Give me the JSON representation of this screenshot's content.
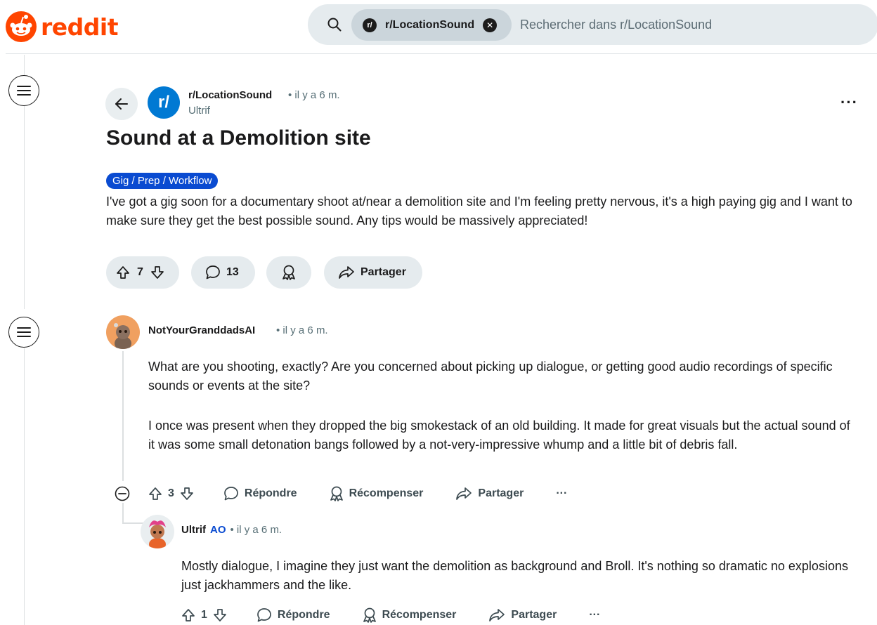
{
  "header": {
    "logo_text": "reddit",
    "search_chip": "r/LocationSound",
    "search_chip_avatar": "r/",
    "search_placeholder": "Rechercher dans r/LocationSound",
    "brand_color": "#ff4500"
  },
  "post": {
    "subreddit": "r/LocationSound",
    "subreddit_avatar": "r/",
    "time": "• il y a 6 m.",
    "author": "Ultrif",
    "title": "Sound at a Demolition site",
    "flair": "Gig / Prep / Workflow",
    "body": "I've got a gig soon for a documentary shoot at/near a demolition site and I'm feeling pretty nervous, it's a high paying gig and I want to make sure they get the best possible sound. Any tips would be massively appreciated!",
    "votes": "7",
    "comments": "13",
    "share_label": "Partager"
  },
  "comments": [
    {
      "author": "NotYourGranddadsAI",
      "time": "• il y a 6 m.",
      "paragraphs": [
        "What are you shooting, exactly? Are you concerned about picking up dialogue, or getting good audio recordings of specific sounds or events at the site?",
        "I once was present when they dropped the big smokestack of an old building. It made for great visuals but the actual sound of it was some small detonation bangs followed by a not-very-impressive whump and a little bit of debris fall."
      ],
      "votes": "3",
      "reply_label": "Répondre",
      "award_label": "Récompenser",
      "share_label": "Partager",
      "more": "···"
    },
    {
      "author": "Ultrif",
      "op_badge": "AO",
      "time": "• il y a 6 m.",
      "paragraphs": [
        "Mostly dialogue, I imagine they just want the demolition as background and Broll. It's nothing so dramatic no explosions just jackhammers and the like."
      ],
      "votes": "1",
      "reply_label": "Répondre",
      "award_label": "Récompenser",
      "share_label": "Partager",
      "more": "···"
    }
  ],
  "icons": {
    "search": "search-icon",
    "back": "arrow-left-icon",
    "menu": "hamburger-icon",
    "upvote": "arrow-up-icon",
    "downvote": "arrow-down-icon",
    "comment": "speech-bubble-icon",
    "award": "award-icon",
    "share": "share-arrow-icon",
    "collapse": "minus-circle-icon",
    "more": "ellipsis-icon"
  }
}
